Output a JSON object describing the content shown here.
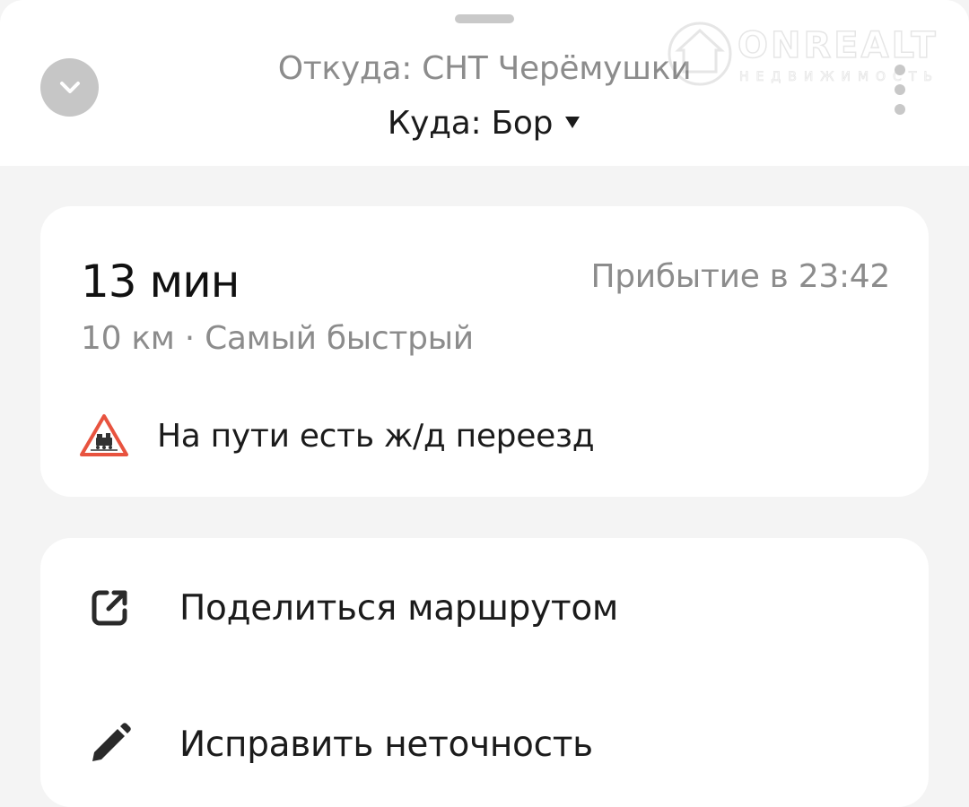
{
  "header": {
    "from_label": "Откуда: СНТ Черёмушки",
    "to_label": "Куда: Бор",
    "collapse_icon": "chevron-down-icon",
    "more_icon": "more-vertical-icon"
  },
  "watermark": {
    "brand": "ONREALT",
    "tagline": "НЕДВИЖИМОСТЬ"
  },
  "route": {
    "duration": "13 мин",
    "arrival": "Прибытие в 23:42",
    "meta": "10 км · Самый быстрый",
    "warning": {
      "text": "На пути есть ж/д переезд",
      "icon": "railway-crossing-warning-icon",
      "color": "#e8533f"
    }
  },
  "actions": [
    {
      "label": "Поделиться маршрутом",
      "icon": "share-icon"
    },
    {
      "label": "Исправить неточность",
      "icon": "pencil-icon"
    }
  ],
  "colors": {
    "background": "#f4f4f4",
    "card": "#ffffff",
    "primary_text": "#1b1b1b",
    "secondary_text": "#8c8c8c",
    "warning_red": "#e8533f"
  }
}
